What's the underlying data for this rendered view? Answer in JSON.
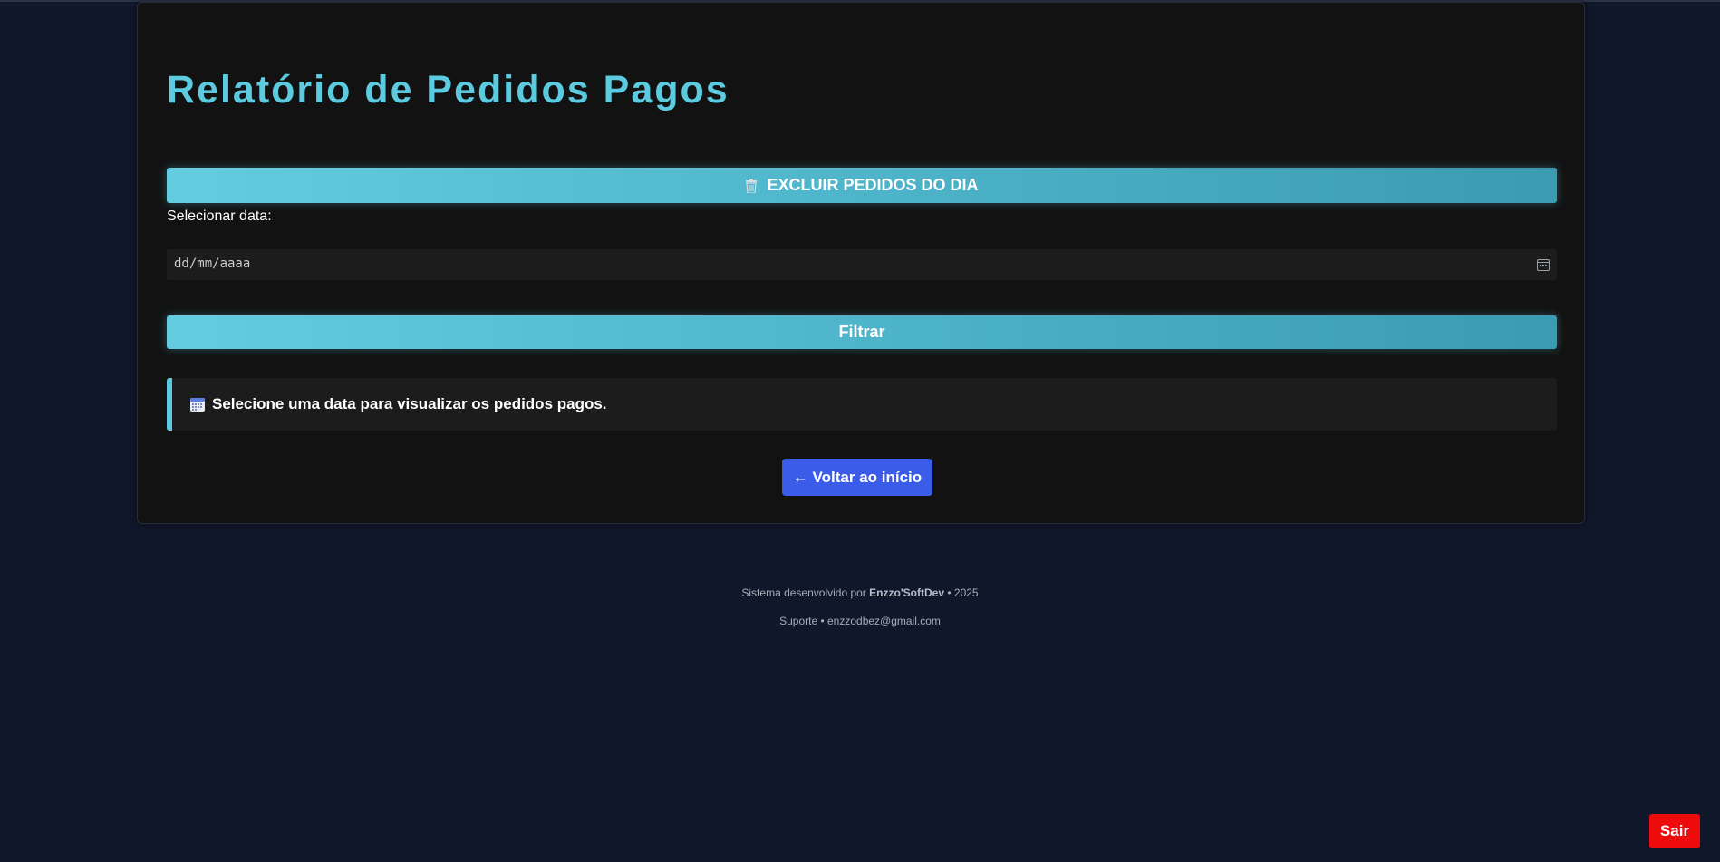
{
  "page": {
    "title": "Relatório de Pedidos Pagos"
  },
  "actions": {
    "delete_day_label": "EXCLUIR PEDIDOS DO DIA",
    "delete_icon": "trash-icon",
    "filter_label": "Filtrar",
    "back_label": "← Voltar ao início",
    "logout_label": "Sair"
  },
  "filter": {
    "date_label": "Selecionar data:",
    "date_placeholder": "dd/mm/aaaa",
    "date_icon": "calendar-icon"
  },
  "info": {
    "icon": "calendar-icon",
    "message": "Selecione uma data para visualizar os pedidos pagos."
  },
  "footer": {
    "line1_prefix": "Sistema desenvolvido por",
    "developer": "Enzzo'SoftDev",
    "line1_suffix": "• 2025",
    "line2": "Suporte • enzzodbez@gmail.com"
  },
  "colors": {
    "background": "#11172a",
    "card": "#121212",
    "accent": "#5ccbe0",
    "back_button": "#3b5ce8",
    "logout_button": "#ee0b0b"
  }
}
